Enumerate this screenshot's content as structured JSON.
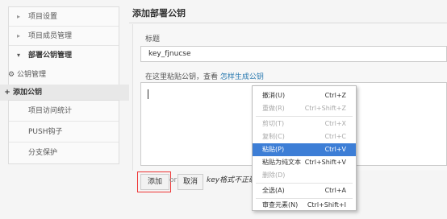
{
  "sidebar": {
    "items": [
      {
        "label": "项目设置",
        "caret": "▸"
      },
      {
        "label": "项目成员管理",
        "caret": "▸"
      },
      {
        "label": "部署公钥管理",
        "caret": "▾"
      }
    ],
    "sub_items": [
      {
        "label": "公钥管理",
        "icon": "⚙"
      },
      {
        "label": "添加公钥",
        "icon": "+"
      }
    ],
    "groups": [
      {
        "label": "项目访问统计"
      },
      {
        "label": "PUSH钩子"
      },
      {
        "label": "分支保护"
      }
    ]
  },
  "main": {
    "page_title": "添加部署公钥",
    "title_label": "标题",
    "title_value": "key_fjnucse",
    "paste_hint": "在这里粘贴公钥，查看 ",
    "paste_link": "怎样生成公钥",
    "add_button": "添加",
    "or_text": "or",
    "cancel_button": "取消",
    "error_text": "key格式不正确"
  },
  "context_menu": {
    "items": [
      {
        "label": "撤消(U)",
        "shortcut": "Ctrl+Z",
        "state": "enabled"
      },
      {
        "label": "重做(R)",
        "shortcut": "Ctrl+Shift+Z",
        "state": "disabled"
      },
      {
        "label": "剪切(T)",
        "shortcut": "Ctrl+X",
        "state": "disabled"
      },
      {
        "label": "复制(C)",
        "shortcut": "Ctrl+C",
        "state": "disabled"
      },
      {
        "label": "粘贴(P)",
        "shortcut": "Ctrl+V",
        "state": "selected"
      },
      {
        "label": "粘贴为纯文本",
        "shortcut": "Ctrl+Shift+V",
        "state": "enabled"
      },
      {
        "label": "删除(D)",
        "shortcut": "",
        "state": "disabled"
      },
      {
        "label": "全选(A)",
        "shortcut": "Ctrl+A",
        "state": "enabled"
      },
      {
        "label": "审查元素(N)",
        "shortcut": "Ctrl+Shift+I",
        "state": "enabled"
      }
    ]
  },
  "colors": {
    "accent": "#3d7ed6",
    "link": "#2a7ab0",
    "highlight_border": "#e33"
  }
}
